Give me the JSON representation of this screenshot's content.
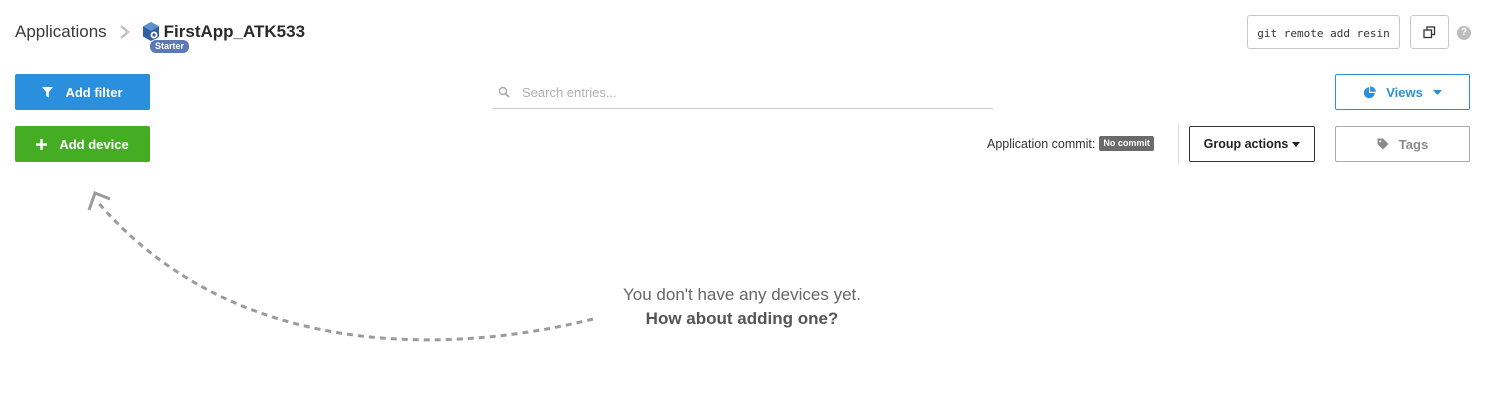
{
  "breadcrumb": {
    "root": "Applications",
    "app_name": "FirstApp_ATK533",
    "plan_badge": "Starter"
  },
  "header": {
    "git_command": "git remote add resin",
    "help": "?"
  },
  "toolbar": {
    "add_filter_label": "Add filter",
    "search_placeholder": "Search entries...",
    "views_label": "Views",
    "add_device_label": "Add device",
    "commit_label": "Application commit:",
    "commit_value": "No commit",
    "group_actions_label": "Group actions",
    "tags_label": "Tags"
  },
  "empty_state": {
    "line1": "You don't have any devices yet.",
    "line2": "How about adding one?"
  },
  "colors": {
    "primary": "#2a8fdc",
    "success": "#45ad24",
    "badge": "#5b79b5",
    "muted": "#bdbdbd"
  },
  "icons": [
    "chevron-right-icon",
    "app-cube-icon",
    "copy-icon",
    "help-icon",
    "filter-icon",
    "plus-icon",
    "search-icon",
    "pie-chart-icon",
    "caret-down-icon",
    "tag-icon",
    "dashed-arrow"
  ]
}
